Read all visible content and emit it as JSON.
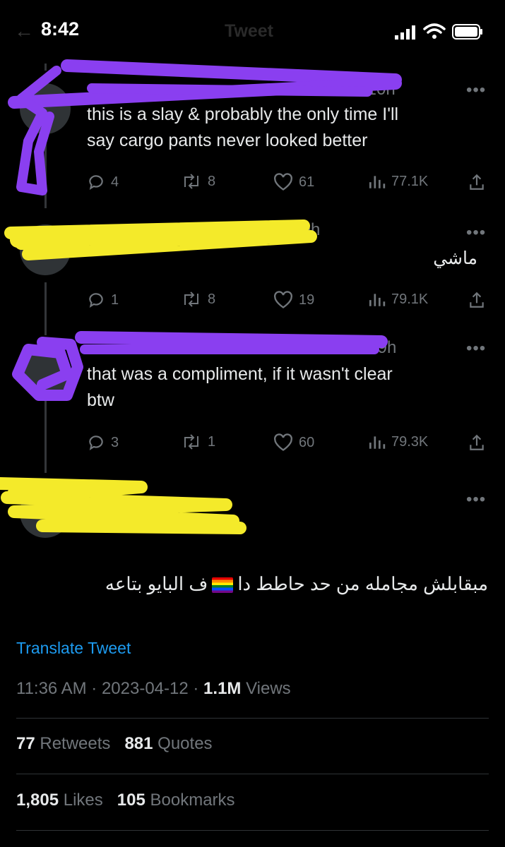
{
  "status_bar": {
    "time": "8:42"
  },
  "header": {
    "title": "Tweet",
    "back_glyph": "←"
  },
  "replies": [
    {
      "meta": "· 10h",
      "text_lines": [
        "this is a slay & probably the only time I'll",
        "say cargo pants never looked better"
      ],
      "replies": "4",
      "retweets": "8",
      "likes": "61",
      "views": "77.1K"
    },
    {
      "meta": "· 9h",
      "text_lines": [
        "ماشي"
      ],
      "replies": "1",
      "retweets": "8",
      "likes": "19",
      "views": "79.1K"
    },
    {
      "meta": "· 9h",
      "text_lines": [
        "that was a compliment, if it wasn't clear",
        "btw"
      ],
      "replies": "3",
      "retweets": "1",
      "likes": "60",
      "views": "79.3K"
    }
  ],
  "more_glyph": "•••",
  "main_tweet": {
    "text_part1": "مبقابلش مجامله من حد حاطط دا",
    "text_part2": "ف البايو بتاعه",
    "translate_label": "Translate Tweet",
    "time": "11:36 AM",
    "date": "2023-04-12",
    "views_count": "1.1M",
    "views_label": "Views",
    "retweets_count": "77",
    "retweets_label": "Retweets",
    "quotes_count": "881",
    "quotes_label": "Quotes",
    "likes_count": "1,805",
    "likes_label": "Likes",
    "bookmarks_count": "105",
    "bookmarks_label": "Bookmarks"
  },
  "colors": {
    "accent": "#1d9bf0",
    "scribble_purple": "#8a3ff0",
    "scribble_yellow": "#f4ea2a"
  }
}
